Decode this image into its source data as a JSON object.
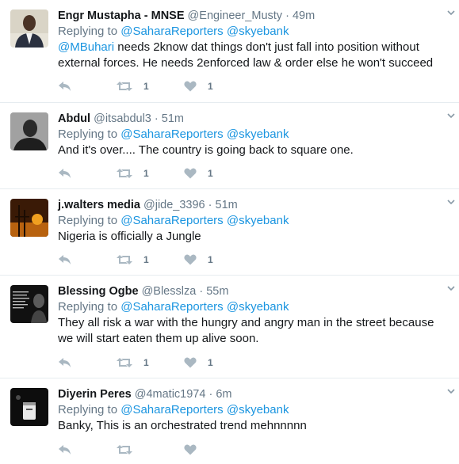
{
  "tweets": [
    {
      "name": "Engr Mustapha - MNSE",
      "handle": "@Engineer_Musty",
      "dot": "·",
      "time": "49m",
      "replying_label": "Replying to",
      "mentions": [
        "@SaharaReporters",
        "@skyebank"
      ],
      "text_mention": "@MBuhari",
      "text": " needs 2know dat things don't just fall into position without external forces. He needs 2enforced law & order else he won't succeed",
      "retweets": "1",
      "likes": "1"
    },
    {
      "name": "Abdul",
      "handle": "@itsabdul3",
      "dot": "·",
      "time": "51m",
      "replying_label": "Replying to",
      "mentions": [
        "@SaharaReporters",
        "@skyebank"
      ],
      "text_mention": "",
      "text": "And it's over.... The country is going back to square one.",
      "retweets": "1",
      "likes": "1"
    },
    {
      "name": "j.walters media",
      "handle": "@jide_3396",
      "dot": "·",
      "time": "51m",
      "replying_label": "Replying to",
      "mentions": [
        "@SaharaReporters",
        "@skyebank"
      ],
      "text_mention": "",
      "text": "Nigeria is officially a Jungle",
      "retweets": "1",
      "likes": "1"
    },
    {
      "name": "Blessing Ogbe",
      "handle": "@Blesslza",
      "dot": "·",
      "time": "55m",
      "replying_label": "Replying to",
      "mentions": [
        "@SaharaReporters",
        "@skyebank"
      ],
      "text_mention": "",
      "text": "They all risk a war with the hungry and angry man in the street because we will start eaten them up alive soon.",
      "retweets": "1",
      "likes": "1"
    },
    {
      "name": "Diyerin Peres",
      "handle": "@4matic1974",
      "dot": "·",
      "time": "6m",
      "replying_label": "Replying to",
      "mentions": [
        "@SaharaReporters",
        "@skyebank"
      ],
      "text_mention": "",
      "text": "Banky, This is an orchestrated trend mehnnnnn",
      "retweets": "",
      "likes": ""
    }
  ],
  "icons": {
    "reply": "reply-icon",
    "retweet": "retweet-icon",
    "like": "heart-icon",
    "more": "chevron-down-icon"
  },
  "colors": {
    "name": "#14171a",
    "muted": "#657786",
    "link": "#1b95e0",
    "action": "#aab8c2",
    "divider": "#e6ecf0"
  }
}
